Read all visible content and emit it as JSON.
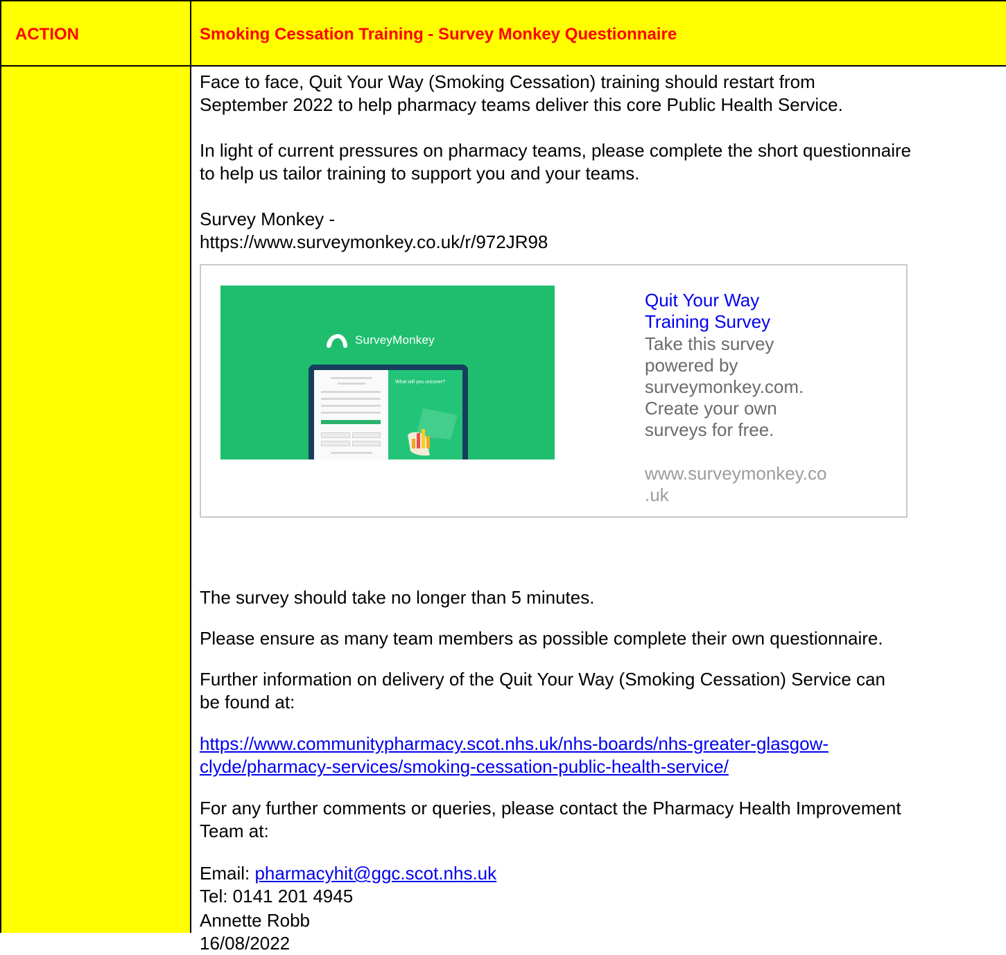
{
  "header": {
    "action_label": "ACTION",
    "title": "Smoking Cessation Training - Survey Monkey Questionnaire"
  },
  "body": {
    "intro_line1": "Face to face, Quit Your Way (Smoking Cessation) training should restart from",
    "intro_line2": "September 2022 to help pharmacy teams deliver this core Public Health Service.",
    "pressures_line1": "In light of current pressures on pharmacy teams, please complete the short questionnaire",
    "pressures_line2": "to help us tailor training to support you and your teams.",
    "survey_label": "Survey Monkey -",
    "survey_url": "https://www.surveymonkey.co.uk/r/972JR98",
    "duration": "The survey should take no longer than 5 minutes.",
    "ensure": "Please ensure as many team members as possible complete their own questionnaire.",
    "further_line1": "Further information on delivery of the Quit Your Way (Smoking Cessation) Service can",
    "further_line2": "be found at:",
    "info_link_line1": "https://www.communitypharmacy.scot.nhs.uk/nhs-boards/nhs-greater-glasgow-",
    "info_link_line2": "clyde/pharmacy-services/smoking-cessation-public-health-service/",
    "comments_line1": "For any further comments or queries, please contact the Pharmacy Health Improvement",
    "comments_line2": "Team at:",
    "email_label": "Email: ",
    "email_address": "pharmacyhit@ggc.scot.nhs.uk",
    "tel": "Tel: 0141 201 4945",
    "signature_name": "Annette Robb",
    "signature_date": "16/08/2022"
  },
  "preview": {
    "title_line1": "Quit Your Way",
    "title_line2": "Training Survey",
    "desc_line1": "Take this survey",
    "desc_line2": "powered by",
    "desc_line3": "surveymonkey.com.",
    "desc_line4": "Create your own",
    "desc_line5": "surveys for free.",
    "domain_line1": "www.surveymonkey.co",
    "domain_line2": ".uk",
    "image": {
      "brand": "SurveyMonkey",
      "tagline": "What will you uncover?",
      "logo_icon": "surveymonkey-logo-icon",
      "background_color": "#1fbe6e"
    }
  },
  "colors": {
    "highlight": "#ffff00",
    "heading_red": "#ff0000",
    "link_blue": "#0000ee"
  }
}
